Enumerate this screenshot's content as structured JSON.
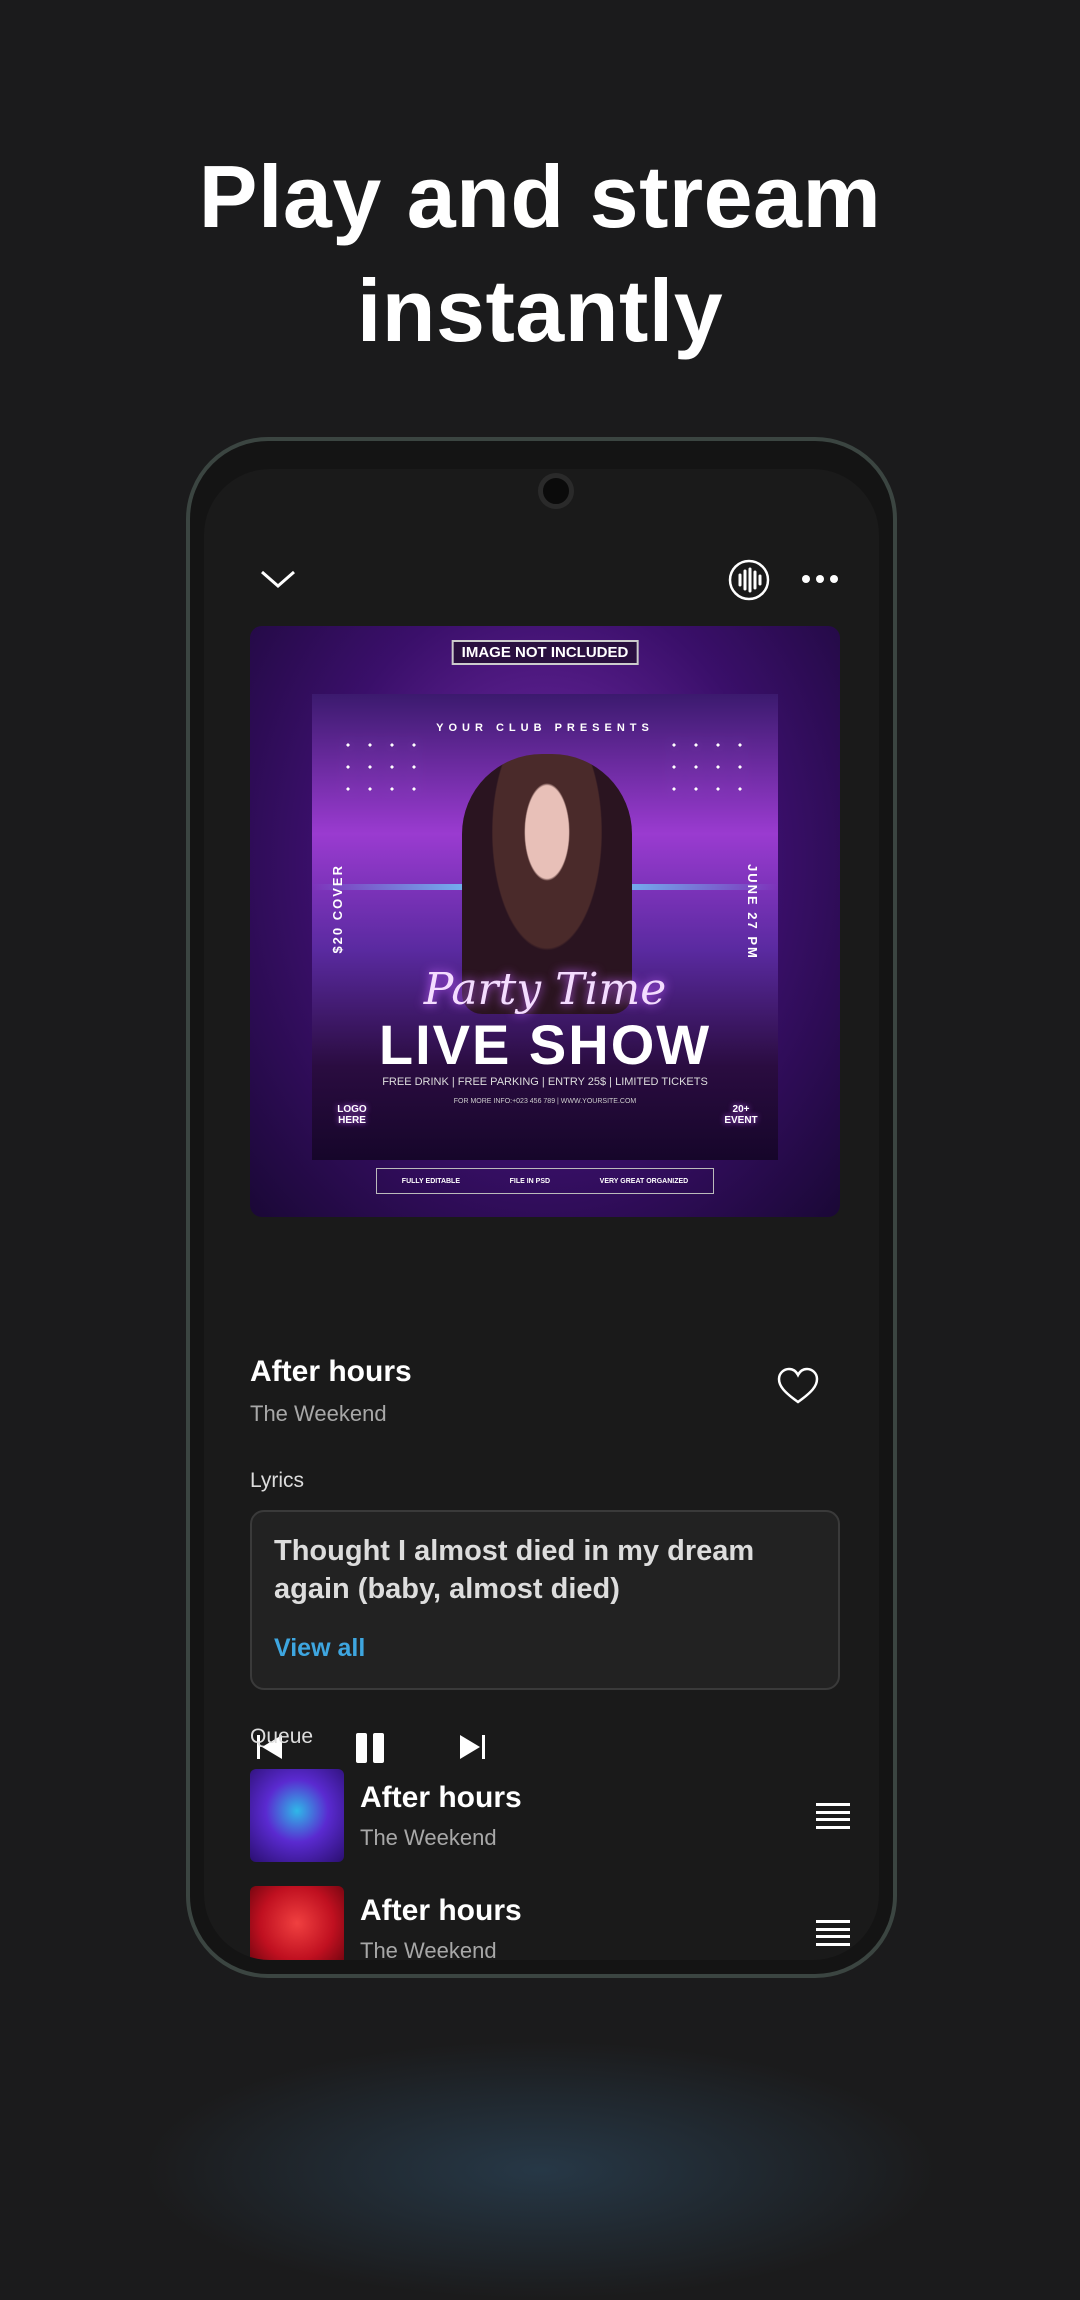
{
  "headline": {
    "line1": "Play and stream",
    "line2": "instantly"
  },
  "player": {
    "icons": {
      "collapse": "chevron-down-icon",
      "visualizer": "waveform-icon",
      "more": "more-dots-icon",
      "prev": "skip-previous-icon",
      "pause": "pause-icon",
      "next": "skip-next-icon",
      "like": "heart-icon",
      "reorder": "drag-handle-icon"
    },
    "album_art": {
      "tag": "IMAGE NOT INCLUDED",
      "presents": "YOUR CLUB PRESENTS",
      "left_vertical": "$20 COVER",
      "right_vertical": "JUNE 27 PM",
      "script": "Party Time",
      "headline": "LIVE SHOW",
      "details": "FREE DRINK | FREE PARKING | ENTRY 25$ | LIMITED TICKETS",
      "info": "FOR MORE INFO:+023 456 789 | WWW.YOURSITE.COM",
      "logo": "LOGO HERE",
      "event": "20+ EVENT",
      "features": [
        "FULLY EDITABLE",
        "FILE IN PSD",
        "VERY GREAT ORGANIZED"
      ]
    },
    "track": {
      "title": "After hours",
      "artist": "The Weekend"
    },
    "lyrics": {
      "label": "Lyrics",
      "text": "Thought I almost died in my dream again (baby, almost died)",
      "view_all": "View all"
    },
    "queue": {
      "label": "Queue",
      "items": [
        {
          "title": "After hours",
          "artist": "The Weekend"
        },
        {
          "title": "After hours",
          "artist": "The Weekend"
        }
      ]
    },
    "colors": {
      "accent": "#3ea6e0",
      "background": "#1a1a1a"
    }
  }
}
